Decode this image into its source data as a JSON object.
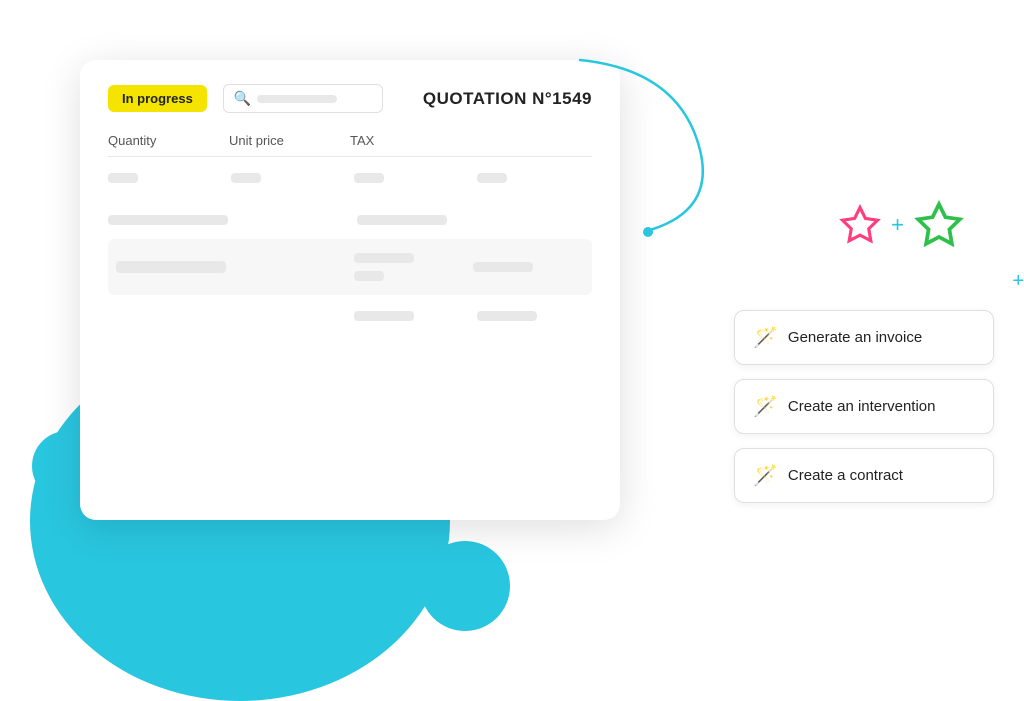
{
  "background": {
    "circle_large_color": "#29c6e0",
    "circle_small_color": "#29c6e0"
  },
  "card": {
    "status_badge": "In progress",
    "quotation_title": "QUOTATION  N°1549",
    "search_placeholder": "",
    "table": {
      "columns": [
        "Quantity",
        "Unit price",
        "TAX",
        ""
      ]
    }
  },
  "stars": {
    "plus_label": "+",
    "plus_right_label": "+"
  },
  "actions": [
    {
      "id": "generate-invoice",
      "label": "Generate an invoice",
      "icon": "✨"
    },
    {
      "id": "create-intervention",
      "label": "Create an intervention",
      "icon": "✨"
    },
    {
      "id": "create-contract",
      "label": "Create a contract",
      "icon": "✨"
    }
  ]
}
